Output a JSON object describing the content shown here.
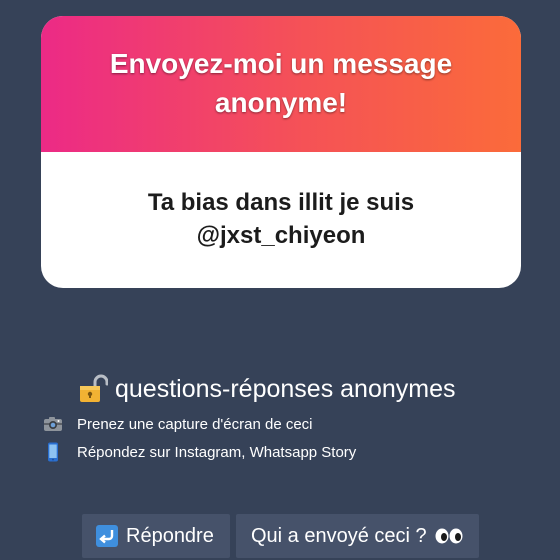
{
  "card": {
    "title": "Envoyez-moi un message anonyme!",
    "message": "Ta bias dans illit je suis @jxst_chiyeon",
    "gradient_start": "#ec2a86",
    "gradient_end": "#fb6b3a"
  },
  "section": {
    "icon": "open-lock-icon",
    "title": "questions-réponses anonymes"
  },
  "tips": [
    {
      "icon": "camera-icon",
      "text": "Prenez une capture d'écran de ceci"
    },
    {
      "icon": "mobile-phone-icon",
      "text": "Répondez sur Instagram, Whatsapp Story"
    }
  ],
  "buttons": {
    "reply": {
      "icon": "reply-arrow-icon",
      "label": "Répondre"
    },
    "who_sent": {
      "icon": "eyes-icon",
      "label": "Qui a envoyé ceci ?"
    }
  },
  "colors": {
    "background": "#364258",
    "button": "#46526a"
  }
}
